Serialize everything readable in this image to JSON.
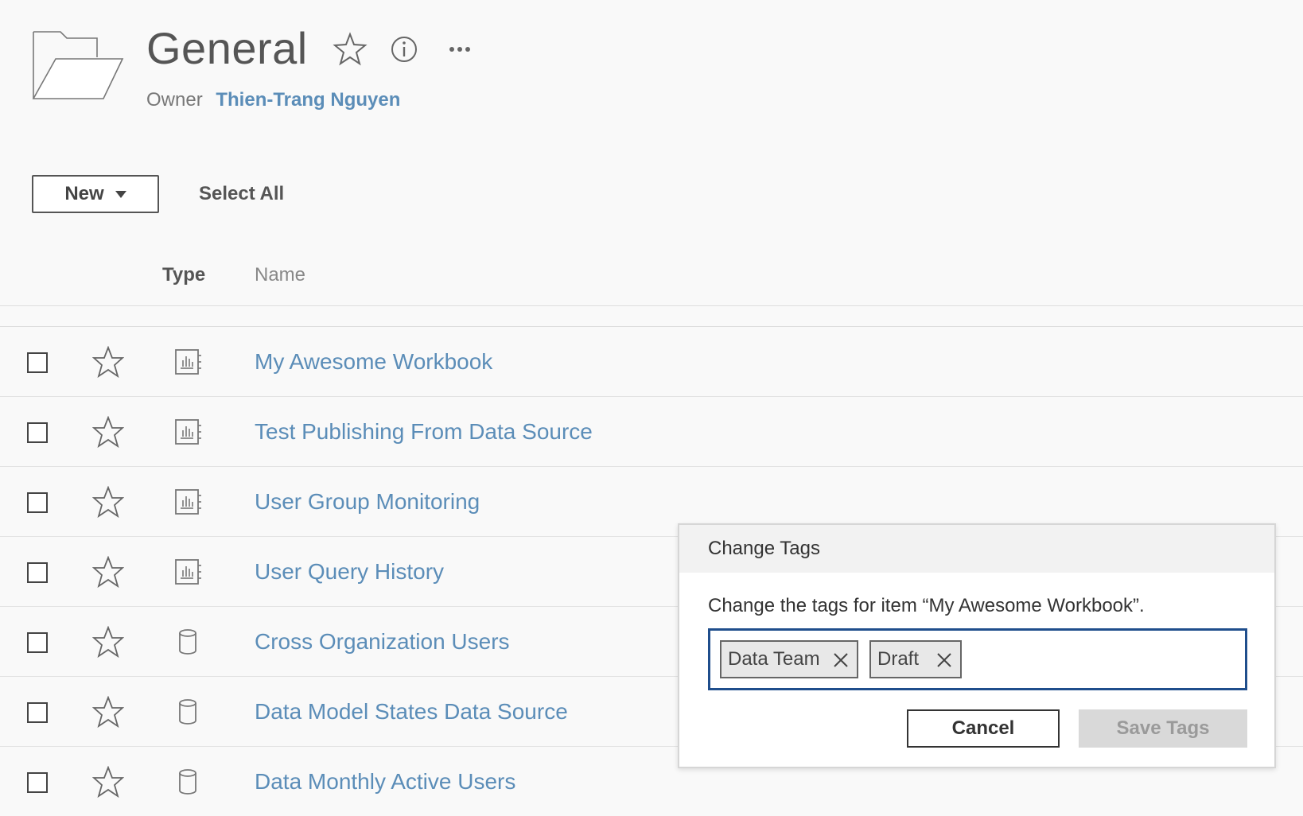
{
  "header": {
    "title": "General",
    "owner_label": "Owner",
    "owner_name": "Thien-Trang Nguyen",
    "icons": [
      "folder-icon",
      "star-icon",
      "info-icon",
      "more-icon"
    ]
  },
  "toolbar": {
    "new_label": "New",
    "select_all_label": "Select All"
  },
  "columns": {
    "type": "Type",
    "name": "Name"
  },
  "rows": [
    {
      "name": "My Awesome Workbook",
      "type_icon": "workbook-icon"
    },
    {
      "name": "Test Publishing From Data Source",
      "type_icon": "workbook-icon"
    },
    {
      "name": "User Group Monitoring",
      "type_icon": "workbook-icon"
    },
    {
      "name": "User Query History",
      "type_icon": "workbook-icon"
    },
    {
      "name": "Cross Organization Users",
      "type_icon": "datasource-icon"
    },
    {
      "name": "Data Model States Data Source",
      "type_icon": "datasource-icon"
    },
    {
      "name": "Data Monthly Active Users",
      "type_icon": "datasource-icon"
    }
  ],
  "dialog": {
    "title": "Change Tags",
    "message": "Change the tags for item “My Awesome Workbook”.",
    "tags": [
      "Data Team",
      "Draft"
    ],
    "cancel_label": "Cancel",
    "save_label": "Save Tags"
  },
  "colors": {
    "link": "#5b8db8",
    "focus_border": "#1f4e8c",
    "disabled_button": "#d9d9d9"
  }
}
